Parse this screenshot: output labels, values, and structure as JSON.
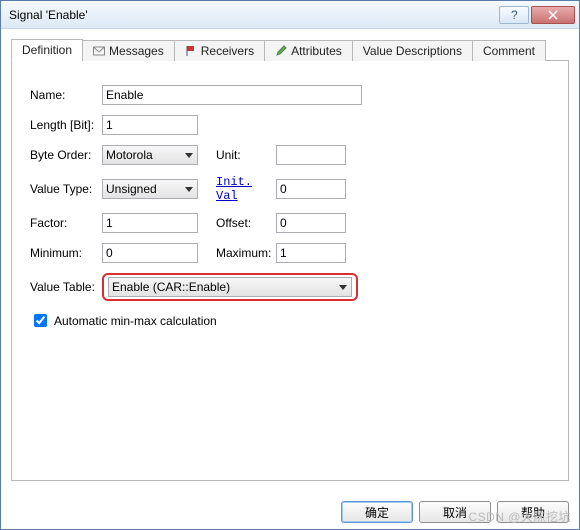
{
  "window": {
    "title": "Signal 'Enable'"
  },
  "tabs": [
    {
      "label": "Definition"
    },
    {
      "label": "Messages"
    },
    {
      "label": "Receivers"
    },
    {
      "label": "Attributes"
    },
    {
      "label": "Value Descriptions"
    },
    {
      "label": "Comment"
    }
  ],
  "form": {
    "name_label": "Name:",
    "name_value": "Enable",
    "length_label": "Length [Bit]:",
    "length_value": "1",
    "byteorder_label": "Byte Order:",
    "byteorder_value": "Motorola",
    "unit_label": "Unit:",
    "unit_value": "",
    "valuetype_label": "Value Type:",
    "valuetype_value": "Unsigned",
    "initval_label": "Init. Val",
    "initval_value": "0",
    "factor_label": "Factor:",
    "factor_value": "1",
    "offset_label": "Offset:",
    "offset_value": "0",
    "minimum_label": "Minimum:",
    "minimum_value": "0",
    "maximum_label": "Maximum:",
    "maximum_value": "1",
    "valuetable_label": "Value Table:",
    "valuetable_value": "Enable (CAR::Enable)",
    "auto_minmax_label": "Automatic min-max calculation",
    "auto_minmax_checked": true
  },
  "buttons": {
    "ok": "确定",
    "cancel": "取消",
    "help": "帮助"
  },
  "watermark": "CSDN @大陈挖坑"
}
